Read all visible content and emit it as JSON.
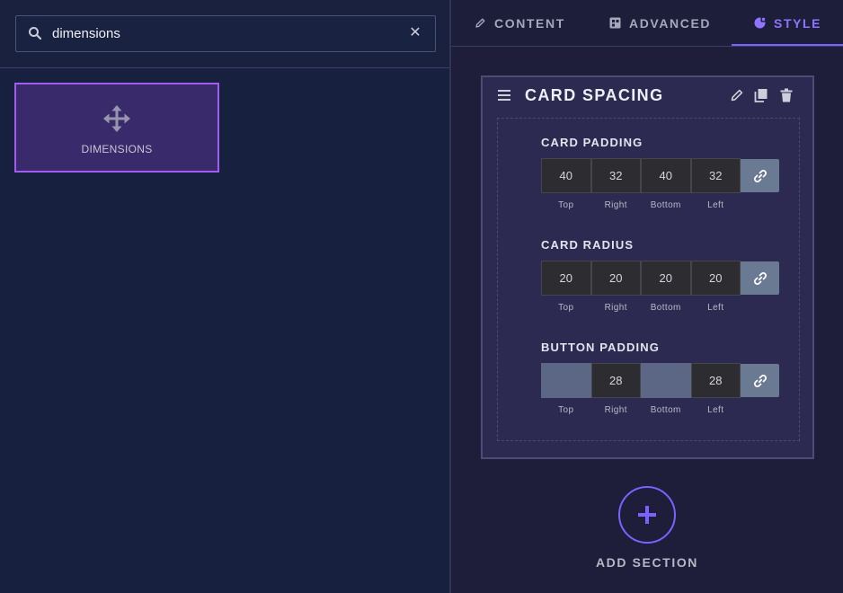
{
  "search": {
    "value": "dimensions",
    "icon": "search-icon",
    "clear_icon": "close-icon"
  },
  "widgets": [
    {
      "label": "DIMENSIONS",
      "icon": "move-arrows-icon"
    }
  ],
  "tabs": [
    {
      "label": "CONTENT",
      "icon": "pencil-icon",
      "active": false
    },
    {
      "label": "ADVANCED",
      "icon": "grid-plus-icon",
      "active": false
    },
    {
      "label": "STYLE",
      "icon": "palette-icon",
      "active": true
    }
  ],
  "section": {
    "title": "CARD SPACING",
    "header_icons": [
      "edit-icon",
      "copy-icon",
      "trash-icon"
    ],
    "fields": [
      {
        "label": "CARD PADDING",
        "values": [
          "40",
          "32",
          "40",
          "32"
        ],
        "sides": [
          "Top",
          "Right",
          "Bottom",
          "Left"
        ]
      },
      {
        "label": "CARD RADIUS",
        "values": [
          "20",
          "20",
          "20",
          "20"
        ],
        "sides": [
          "Top",
          "Right",
          "Bottom",
          "Left"
        ]
      },
      {
        "label": "BUTTON PADDING",
        "values": [
          "",
          "28",
          "",
          "28"
        ],
        "sides": [
          "Top",
          "Right",
          "Bottom",
          "Left"
        ]
      }
    ]
  },
  "add_section": {
    "label": "ADD SECTION"
  },
  "colors": {
    "accent": "#7b61ff",
    "tile_border": "#a35cf0",
    "tile_bg": "#392a6b",
    "link_button": "#6a7a92"
  }
}
